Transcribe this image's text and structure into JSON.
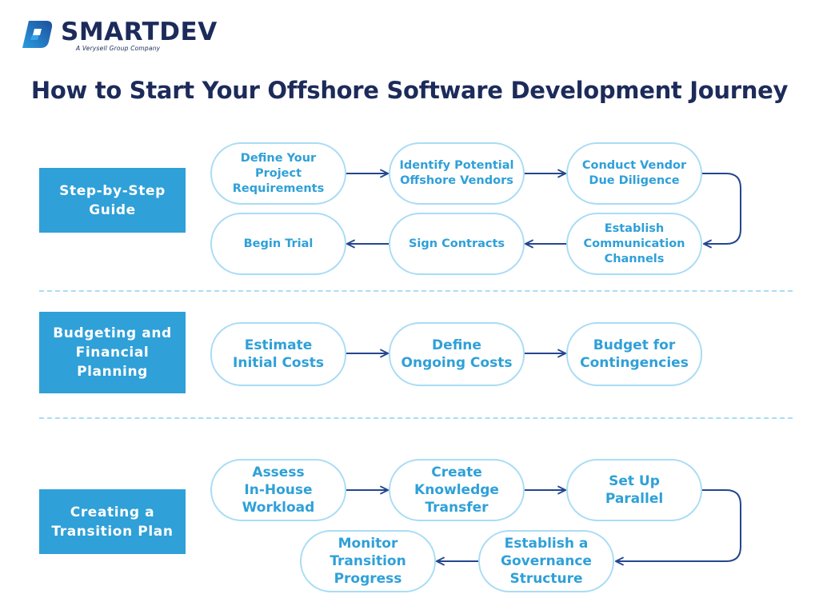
{
  "logo": {
    "name": "SMARTDEV",
    "tagline": "A Verysell Group Company",
    "icon": "smartdev-logo-icon"
  },
  "title": "How to Start Your Offshore Software Development Journey",
  "colors": {
    "navy": "#1c2b5a",
    "accent_blue": "#2fa0d8",
    "pill_border": "#a9dcf5",
    "arrow": "#24468f"
  },
  "sections": [
    {
      "label": "Step-by-Step\nGuide",
      "steps": [
        "Define Your\nProject\nRequirements",
        "Identify Potential\nOffshore Vendors",
        "Conduct Vendor\nDue Diligence",
        "Establish\nCommunication\nChannels",
        "Sign Contracts",
        "Begin Trial"
      ]
    },
    {
      "label": "Budgeting and\nFinancial\nPlanning",
      "steps": [
        "Estimate\nInitial Costs",
        "Define\nOngoing Costs",
        "Budget for\nContingencies"
      ]
    },
    {
      "label": "Creating a\nTransition Plan",
      "steps": [
        "Assess\nIn-House\nWorkload",
        "Create\nKnowledge\nTransfer",
        "Set Up\nParallel",
        "Establish a\nGovernance\nStructure",
        "Monitor\nTransition\nProgress"
      ]
    }
  ]
}
